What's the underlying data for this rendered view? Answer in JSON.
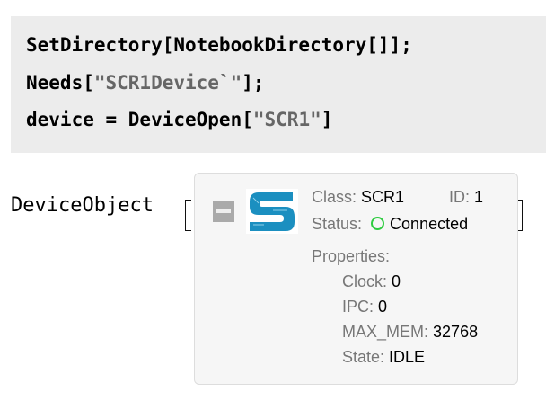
{
  "code": {
    "line1": "SetDirectory[NotebookDirectory[]];",
    "line2_pre": "Needs[",
    "line2_str": "\"SCR1Device`\"",
    "line2_post": "];",
    "line3_pre": "device = DeviceOpen[",
    "line3_str": "\"SCR1\"",
    "line3_post": "]"
  },
  "output": {
    "head": "DeviceObject",
    "class_label": "Class:",
    "class_value": "SCR1",
    "id_label": "ID:",
    "id_value": "1",
    "status_label": "Status:",
    "status_value": "Connected",
    "status_color": "#2ecc40",
    "properties_label": "Properties:",
    "properties": [
      {
        "label": "Clock:",
        "value": "0"
      },
      {
        "label": "IPC:",
        "value": "0"
      },
      {
        "label": "MAX_MEM:",
        "value": "32768"
      },
      {
        "label": "State:",
        "value": "IDLE"
      }
    ],
    "logo_letter": "S"
  }
}
